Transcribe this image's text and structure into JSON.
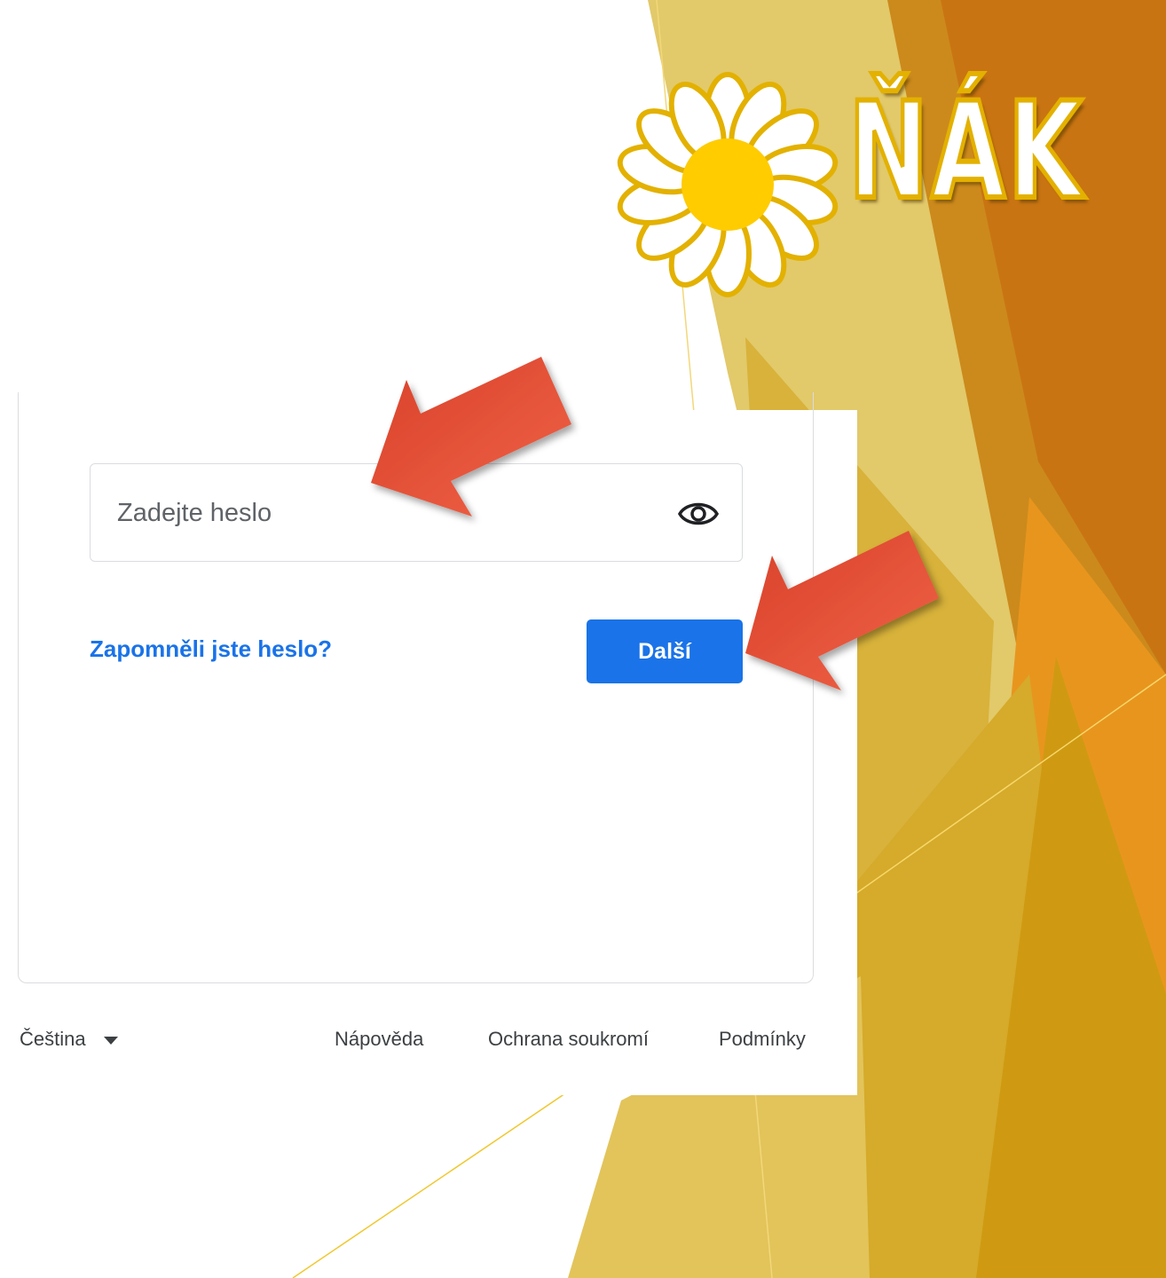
{
  "logo": {
    "text": "ŇÁK",
    "colors": {
      "petal": "#ffffff",
      "center": "#ffcc00",
      "outline": "#e3b100"
    }
  },
  "password": {
    "placeholder": "Zadejte heslo",
    "value": ""
  },
  "forgot_password": {
    "label": "Zapomněli jste heslo?"
  },
  "next_button": {
    "label": "Další"
  },
  "footer": {
    "language": "Čeština",
    "help": "Nápověda",
    "privacy": "Ochrana soukromí",
    "terms": "Podmínky"
  },
  "colors": {
    "accent": "#1a73e8",
    "annotation_arrow": "#e2503a"
  },
  "icons": {
    "password_toggle": "eye-icon",
    "language_dropdown": "caret-down-icon"
  }
}
